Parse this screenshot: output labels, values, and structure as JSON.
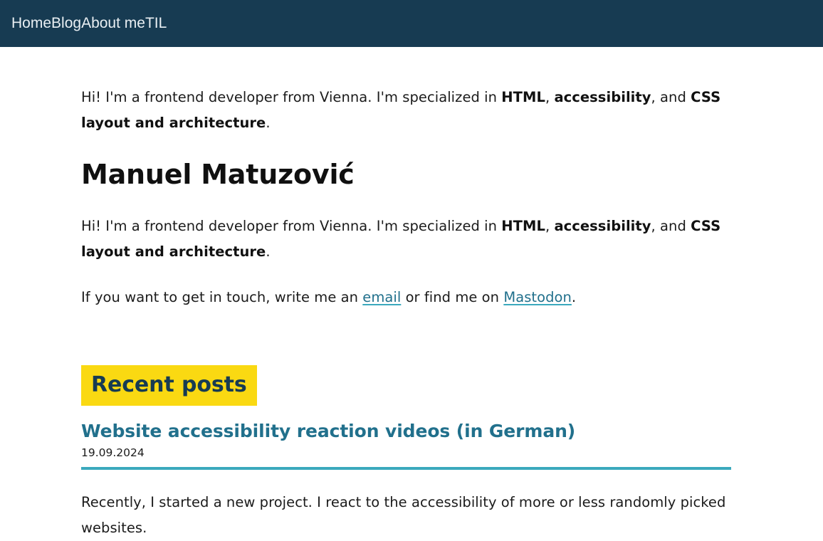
{
  "header": {
    "nav_items": [
      {
        "label": "Home"
      },
      {
        "label": "Blog"
      },
      {
        "label": "About me"
      },
      {
        "label": "TIL"
      }
    ]
  },
  "main": {
    "tagline": {
      "part1": "Hi! I'm a frontend developer from Vienna. I'm specialized in ",
      "strong1": "HTML",
      "sep1": ", ",
      "strong2": "accessibility",
      "sep2": ", and ",
      "strong3": "CSS layout and architecture",
      "end": "."
    },
    "name": "Manuel Matuzović",
    "bio": {
      "part1": "Hi! I'm a frontend developer from Vienna. I'm specialized in ",
      "strong1": "HTML",
      "sep1": ", ",
      "strong2": "accessibility",
      "sep2": ", and ",
      "strong3": "CSS layout and architecture",
      "end": "."
    },
    "contact": {
      "part1": "If you want to get in touch, write me an ",
      "email_link": "email",
      "part2": " or find me on ",
      "mastodon_link": "Mastodon",
      "end": "."
    },
    "section_title": "Recent posts",
    "posts": [
      {
        "title": "Website accessibility reaction videos (in German)",
        "date": "19.09.2024",
        "excerpt": "Recently, I started a new project. I react to the accessibility of more or less randomly picked websites."
      }
    ]
  },
  "colors": {
    "header_bg": "#173b52",
    "highlight_yellow": "#fad912",
    "link_teal": "#21708c",
    "rule_teal": "#3ba9bd",
    "page_bg": "#ffffff",
    "body_text": "#1b1b1b"
  }
}
